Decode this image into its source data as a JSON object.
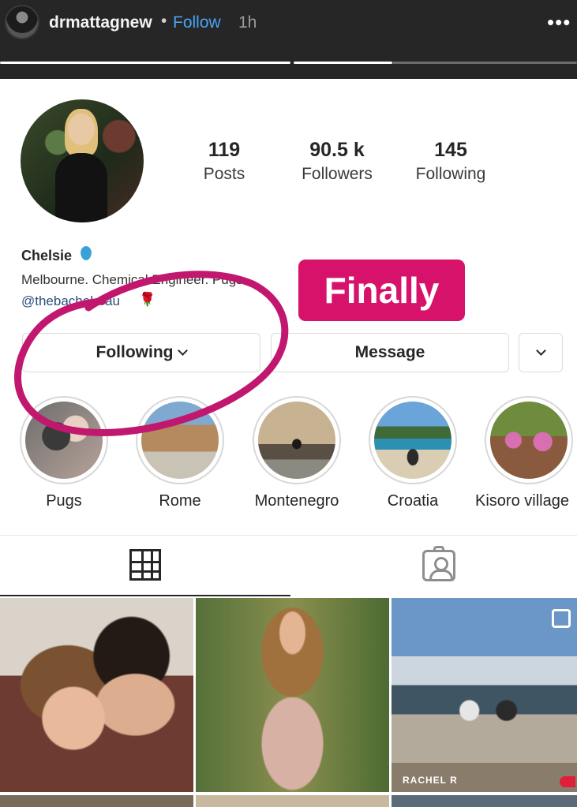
{
  "story": {
    "username": "drmattagnew",
    "separator": "•",
    "follow_label": "Follow",
    "time": "1h",
    "more_glyph": "•••"
  },
  "profile": {
    "stats": [
      {
        "value": "119",
        "label": "Posts"
      },
      {
        "value": "90.5 k",
        "label": "Followers"
      },
      {
        "value": "145",
        "label": "Following"
      }
    ],
    "name": "Chelsie",
    "bio_line": "Melbourne. Chemical Engineer. Pugs.",
    "handle": "@thebachelorau",
    "rose_glyph": "🌹",
    "sticker_text": "Finally",
    "buttons": {
      "following_label": "Following",
      "message_label": "Message"
    },
    "highlights": [
      {
        "label": "Pugs"
      },
      {
        "label": "Rome"
      },
      {
        "label": "Montenegro"
      },
      {
        "label": "Croatia"
      },
      {
        "label": "Kisoro village"
      }
    ],
    "photo_tag": "RACHEL R"
  },
  "colors": {
    "follow_blue": "#4aa3f5",
    "sticker_pink": "#d6126b",
    "annotation_magenta": "#c2176e"
  }
}
